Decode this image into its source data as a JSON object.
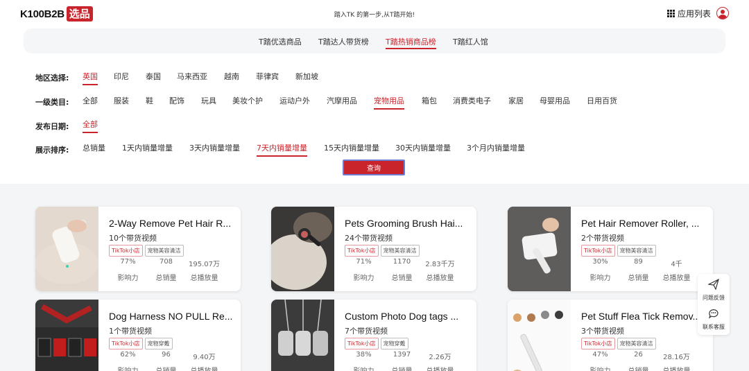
{
  "logo": {
    "text": "K100B2B",
    "badge": "选品"
  },
  "slogan": "踏入TK 的第一步,从T踏开始!",
  "applist_label": "应用列表",
  "tabs": [
    {
      "label": "T踏优选商品",
      "active": false
    },
    {
      "label": "T踏达人带货榜",
      "active": false
    },
    {
      "label": "T踏热销商品榜",
      "active": true
    },
    {
      "label": "T踏红人馆",
      "active": false
    }
  ],
  "filters": {
    "region": {
      "label": "地区选择:",
      "options": [
        "英国",
        "印尼",
        "泰国",
        "马来西亚",
        "越南",
        "菲律宾",
        "新加坡"
      ],
      "active": "英国"
    },
    "category": {
      "label": "一级类目:",
      "options": [
        "全部",
        "服装",
        "鞋",
        "配饰",
        "玩具",
        "美妆个护",
        "运动户外",
        "汽摩用品",
        "宠物用品",
        "箱包",
        "消费类电子",
        "家居",
        "母婴用品",
        "日用百货"
      ],
      "active": "宠物用品"
    },
    "date": {
      "label": "发布日期:",
      "options": [
        "全部"
      ],
      "active": "全部"
    },
    "sort": {
      "label": "展示排序:",
      "options": [
        "总销量",
        "1天内销量增量",
        "3天内销量增量",
        "7天内销量增量",
        "15天内销量增量",
        "30天内销量增量",
        "3个月内销量增量"
      ],
      "active": "7天内销量增量"
    }
  },
  "query_label": "查询",
  "stat_keys": [
    "影响力",
    "总销量",
    "总播放量"
  ],
  "products": [
    {
      "title": "2-Way Remove Pet Hair R...",
      "videos": "10个带货视频",
      "tags": [
        "TikTok小店",
        "宠物美容清洁"
      ],
      "stats": [
        "77%",
        "708",
        "195.07万"
      ]
    },
    {
      "title": "Pets Grooming Brush Hai...",
      "videos": "24个带货视频",
      "tags": [
        "TikTok小店",
        "宠物美容清洁"
      ],
      "stats": [
        "71%",
        "1170",
        "2.83千万"
      ]
    },
    {
      "title": "Pet Hair Remover Roller, ...",
      "videos": "2个带货视频",
      "tags": [
        "TikTok小店",
        "宠物美容清洁"
      ],
      "stats": [
        "30%",
        "89",
        "4千"
      ]
    },
    {
      "title": "Dog Harness NO PULL Re...",
      "videos": "1个带货视频",
      "tags": [
        "TikTok小店",
        "宠物穿戴"
      ],
      "stats": [
        "62%",
        "96",
        "9.40万"
      ]
    },
    {
      "title": "Custom Photo Dog tags ...",
      "videos": "7个带货视频",
      "tags": [
        "TikTok小店",
        "宠物穿戴"
      ],
      "stats": [
        "38%",
        "1397",
        "2.26万"
      ]
    },
    {
      "title": "Pet Stuff Flea Tick Remov...",
      "videos": "3个带货视频",
      "tags": [
        "TikTok小店",
        "宠物美容清洁"
      ],
      "stats": [
        "47%",
        "26",
        "28.16万"
      ]
    }
  ],
  "side": {
    "feedback": "问题反馈",
    "support": "联系客服"
  },
  "colors": {
    "accent": "#c9242b",
    "background": "#f4f5f7"
  }
}
